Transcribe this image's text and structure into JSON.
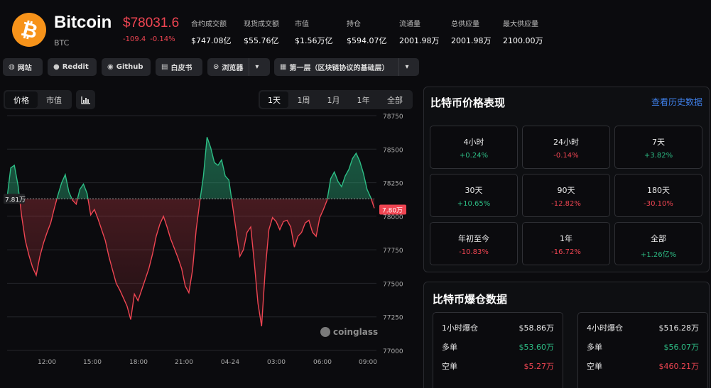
{
  "coin": {
    "logo_symbol": "₿",
    "name": "Bitcoin",
    "symbol": "BTC",
    "price": "$78031.6",
    "change_abs": "-109.4",
    "change_pct": "-0.14%"
  },
  "stats": [
    {
      "label": "合约成交额",
      "value": "$747.08亿"
    },
    {
      "label": "现货成交额",
      "value": "$55.76亿"
    },
    {
      "label": "市值",
      "value": "$1.56万亿"
    },
    {
      "label": "持仓",
      "value": "$594.07亿"
    },
    {
      "label": "流通量",
      "value": "2001.98万"
    },
    {
      "label": "总供应量",
      "value": "2001.98万"
    },
    {
      "label": "最大供应量",
      "value": "2100.00万"
    }
  ],
  "links": [
    {
      "label": "网站",
      "icon": "globe-icon"
    },
    {
      "label": "Reddit",
      "icon": "reddit-icon"
    },
    {
      "label": "Github",
      "icon": "github-icon"
    },
    {
      "label": "白皮书",
      "icon": "document-icon"
    },
    {
      "label": "浏览器",
      "icon": "explorer-icon"
    },
    {
      "label": "第一层（区块链协议的基础层）",
      "icon": "grid-icon"
    }
  ],
  "chart_tabs": [
    "价格",
    "市值"
  ],
  "range_tabs": [
    "1天",
    "1周",
    "1月",
    "1年",
    "全部"
  ],
  "watermark": "coinglass",
  "colors": {
    "up": "#2dbd85",
    "down": "#ef4552",
    "accent": "#f7931a",
    "link": "#3f7fe8"
  },
  "chart_data": {
    "type": "area",
    "baseline": 78130,
    "baseline_label": "7.81万",
    "last_label": "7.80万",
    "ylim": [
      77000,
      78750
    ],
    "yticks": [
      "78750",
      "78500",
      "78250",
      "78000",
      "77750",
      "77500",
      "77250",
      "77000"
    ],
    "xticks": [
      "12:00",
      "15:00",
      "18:00",
      "21:00",
      "04-24",
      "03:00",
      "06:00",
      "09:00"
    ],
    "series": [
      {
        "values": [
          78140,
          78360,
          78380,
          78230,
          78000,
          77820,
          77710,
          77620,
          77560,
          77700,
          77800,
          77880,
          77950,
          78060,
          78160,
          78250,
          78310,
          78180,
          78120,
          78090,
          78200,
          78240,
          78170,
          78010,
          78050,
          77980,
          77900,
          77820,
          77700,
          77600,
          77500,
          77450,
          77390,
          77330,
          77230,
          77420,
          77370,
          77450,
          77530,
          77610,
          77720,
          77850,
          77940,
          78000,
          77920,
          77830,
          77760,
          77690,
          77610,
          77480,
          77430,
          77600,
          77900,
          78110,
          78300,
          78590,
          78510,
          78400,
          78380,
          78420,
          78300,
          78270,
          78080,
          77890,
          77700,
          77750,
          77880,
          77920,
          77650,
          77350,
          77180,
          77600,
          77900,
          77990,
          77960,
          77900,
          77960,
          77970,
          77920,
          77770,
          77850,
          77880,
          77950,
          77970,
          77880,
          77850,
          77990,
          78050,
          78120,
          78280,
          78330,
          78260,
          78220,
          78300,
          78350,
          78430,
          78470,
          78410,
          78320,
          78200,
          78140,
          78060
        ]
      }
    ]
  },
  "performance": {
    "title": "比特币价格表现",
    "link": "查看历史数据",
    "cells": [
      {
        "label": "4小时",
        "value": "+0.24%",
        "dir": "up"
      },
      {
        "label": "24小时",
        "value": "-0.14%",
        "dir": "down"
      },
      {
        "label": "7天",
        "value": "+3.82%",
        "dir": "up"
      },
      {
        "label": "30天",
        "value": "+10.65%",
        "dir": "up"
      },
      {
        "label": "90天",
        "value": "-12.82%",
        "dir": "down"
      },
      {
        "label": "180天",
        "value": "-30.10%",
        "dir": "down"
      },
      {
        "label": "年初至今",
        "value": "-10.83%",
        "dir": "down"
      },
      {
        "label": "1年",
        "value": "-16.72%",
        "dir": "down"
      },
      {
        "label": "全部",
        "value": "+1.26亿%",
        "dir": "up"
      }
    ]
  },
  "liquidation": {
    "title": "比特币爆仓数据",
    "cards": [
      {
        "rows": [
          {
            "label": "1小时爆仓",
            "value": "$58.86万",
            "dir": "none"
          },
          {
            "label": "多单",
            "value": "$53.60万",
            "dir": "up"
          },
          {
            "label": "空单",
            "value": "$5.27万",
            "dir": "down"
          }
        ]
      },
      {
        "rows": [
          {
            "label": "4小时爆仓",
            "value": "$516.28万",
            "dir": "none"
          },
          {
            "label": "多单",
            "value": "$56.07万",
            "dir": "up"
          },
          {
            "label": "空单",
            "value": "$460.21万",
            "dir": "down"
          }
        ]
      }
    ]
  }
}
